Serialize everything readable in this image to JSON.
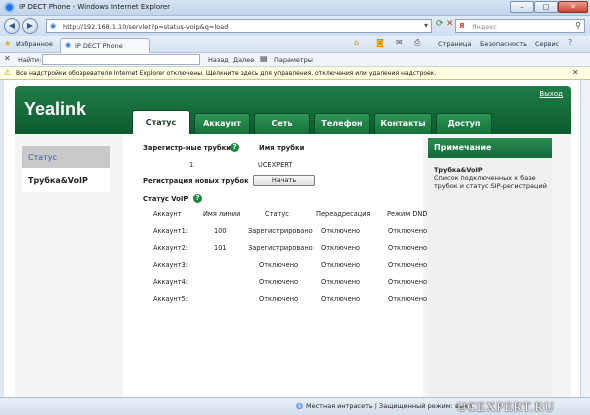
{
  "window": {
    "title": "IP DECT Phone - Windows Internet Explorer",
    "min": "–",
    "max": "□",
    "close": "✕"
  },
  "address": {
    "url": "http://192.168.1.10/servlet?p=status-voip&q=load",
    "search_placeholder": "Яндекс"
  },
  "favbar": {
    "favorites": "Избранное",
    "tab": "IP DECT Phone",
    "page": "Страница",
    "safety": "Безопасность",
    "service": "Сервис"
  },
  "findbar": {
    "label": "Найти:",
    "back": "Назад",
    "next": "Далее",
    "params": "Параметры"
  },
  "infobar": {
    "text": "Все надстройки обозревателя Internet Explorer отключены. Щелкните здесь для управления, отключения или удаления надстроек."
  },
  "header": {
    "logo": "Yealink",
    "logout": "Выход",
    "tabs": [
      "Статус",
      "Аккаунт",
      "Сеть",
      "Телефон",
      "Контакты",
      "Доступ"
    ]
  },
  "left_nav": {
    "status": "Статус",
    "voip": "Трубка&VoIP"
  },
  "main": {
    "registered_label": "Зарегистр-ные трубки",
    "handset_name_label": "Имя трубки",
    "handset_number": "1",
    "handset_name": "UCEXPERT",
    "new_reg_label": "Регистрация новых трубок",
    "start_button": "Начать",
    "voip_status_label": "Статус VoIP",
    "table": {
      "headers": [
        "Аккаунт",
        "Имя линии",
        "Статус",
        "Переадресация",
        "Режим DND"
      ],
      "rows": [
        [
          "Аккаунт1:",
          "100",
          "Зарегистрировано",
          "Отключено",
          "Отключено"
        ],
        [
          "Аккаунт2:",
          "101",
          "Зарегистрировано",
          "Отключено",
          "Отключено"
        ],
        [
          "Аккаунт3:",
          "",
          "Отключено",
          "Отключено",
          "Отключено"
        ],
        [
          "Аккаунт4:",
          "",
          "Отключено",
          "Отключено",
          "Отключено"
        ],
        [
          "Аккаунт5:",
          "",
          "Отключено",
          "Отключено",
          "Отключено"
        ]
      ]
    }
  },
  "note": {
    "header": "Примечание",
    "title": "Трубка&VoIP",
    "text": "Список подключенных к базе трубок и статус SIP-регистраций"
  },
  "statusbar": {
    "zone": "Местная интрасеть | Защищенный режим: выкл."
  },
  "watermark": "UCEXPERT.RU",
  "colors": {
    "brand_green": "#15703a",
    "ie_blue": "#2a73d8"
  }
}
